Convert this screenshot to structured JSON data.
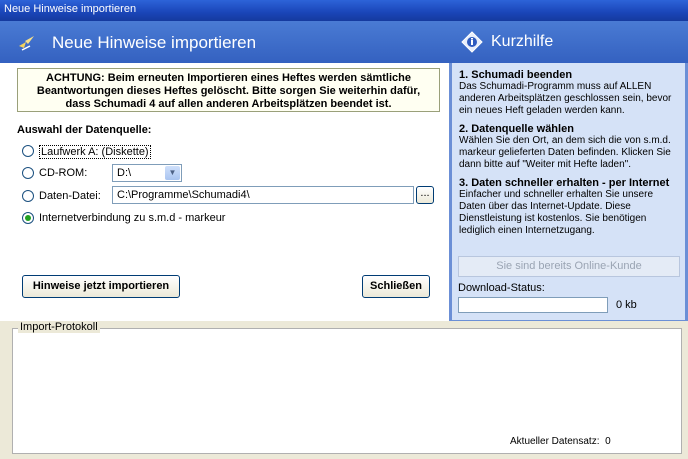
{
  "window": {
    "title": "Neue Hinweise importieren"
  },
  "header": {
    "title": "Neue Hinweise importieren"
  },
  "warning": "ACHTUNG: Beim erneuten Importieren eines Heftes werden sämtliche Beantwortungen dieses Heftes gelöscht. Bitte sorgen Sie weiterhin dafür, dass Schumadi 4 auf allen anderen Arbeitsplätzen beendet ist.",
  "source": {
    "heading": "Auswahl der Datenquelle:",
    "options": {
      "drive_a": "Laufwerk A: (Diskette)",
      "cdrom": "CD-ROM:",
      "file": "Daten-Datei:",
      "internet": "Internetverbindung zu s.m.d - markeur"
    },
    "cdrom_value": "D:\\",
    "file_value": "C:\\Programme\\Schumadi4\\",
    "browse_label": "...",
    "selected": "internet"
  },
  "buttons": {
    "import": "Hinweise jetzt importieren",
    "close": "Schließen"
  },
  "help": {
    "title": "Kurzhilfe",
    "sections": [
      {
        "heading": "1. Schumadi beenden",
        "text": "Das Schumadi-Programm muss auf ALLEN anderen Arbeitsplätzen geschlossen sein, bevor ein neues Heft geladen werden kann."
      },
      {
        "heading": "2. Datenquelle wählen",
        "text": "Wählen Sie den Ort, an dem sich die von s.m.d. markeur gelieferten Daten befinden. Klicken Sie dann bitte auf \"Weiter mit Hefte laden\"."
      },
      {
        "heading": "3. Daten schneller erhalten - per Internet",
        "text": "Einfacher und schneller erhalten Sie unsere Daten über das Internet-Update. Diese Dienstleistung ist kostenlos. Sie benötigen lediglich einen Internetzugang."
      }
    ],
    "online_button": "Sie sind bereits Online-Kunde",
    "download_label": "Download-Status:",
    "download_value": "0 kb"
  },
  "log": {
    "label": "Import-Protokoll",
    "current_label": "Aktueller Datensatz:",
    "current_value": "0"
  }
}
